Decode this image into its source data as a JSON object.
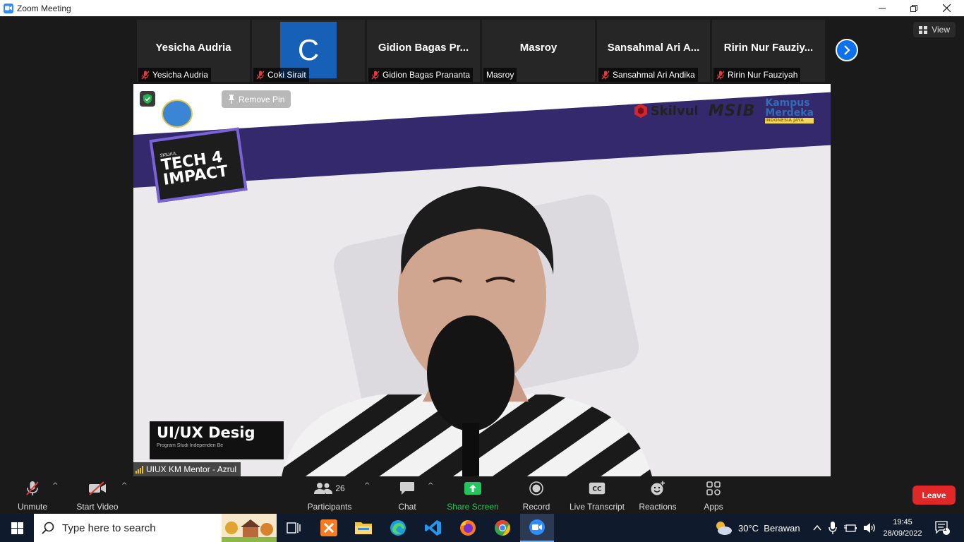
{
  "window": {
    "title": "Zoom Meeting",
    "minimize": "—",
    "maximize": "❐",
    "close": "✕"
  },
  "view_button": {
    "label": "View"
  },
  "thumbnails": [
    {
      "display_name": "Yesicha Audria",
      "label": "Yesicha Audria",
      "muted": true
    },
    {
      "avatar_letter": "C",
      "label": "Coki Sirait",
      "muted": true
    },
    {
      "display_name": "Gidion Bagas Pr...",
      "label": "Gidion Bagas Prananta",
      "muted": true
    },
    {
      "display_name": "Masroy",
      "label": "Masroy",
      "muted": false
    },
    {
      "display_name": "Sansahmal Ari A...",
      "label": "Sansahmal Ari Andika",
      "muted": true
    },
    {
      "display_name": "Ririn Nur Fauziy...",
      "label": "Ririn Nur Fauziyah",
      "muted": true
    }
  ],
  "main_video": {
    "remove_pin": "Remove Pin",
    "speaker_label": "UIUX KM Mentor - Azrul",
    "slide": {
      "tech_small": "SKILVUL",
      "tech_line1": "TECH 4",
      "tech_line2": "IMPACT",
      "partner_skilvul": "Skilvul",
      "partner_msib": "MSIB",
      "partner_kampus1": "Kampus",
      "partner_kampus2": "Merdeka",
      "partner_kampus_sub": "INDONESIA JAYA",
      "uiux_title": "UI/UX Desig",
      "uiux_subtitle": "Program Studi Independen Be"
    }
  },
  "toolbar": {
    "unmute": "Unmute",
    "start_video": "Start Video",
    "participants": "Participants",
    "participant_count": "26",
    "chat": "Chat",
    "share_screen": "Share Screen",
    "record": "Record",
    "live_transcript": "Live Transcript",
    "reactions": "Reactions",
    "apps": "Apps",
    "leave": "Leave",
    "caret": "^"
  },
  "taskbar": {
    "search_placeholder": "Type here to search",
    "weather": "30°C  Berawan",
    "time": "19:45",
    "date": "28/09/2022",
    "notifications": "1"
  },
  "colors": {
    "zoom_blue": "#2d8cff",
    "leave_red": "#e02828",
    "share_green": "#22c55e",
    "slide_band": "#35296e",
    "taskbar": "#0f1b2c"
  }
}
